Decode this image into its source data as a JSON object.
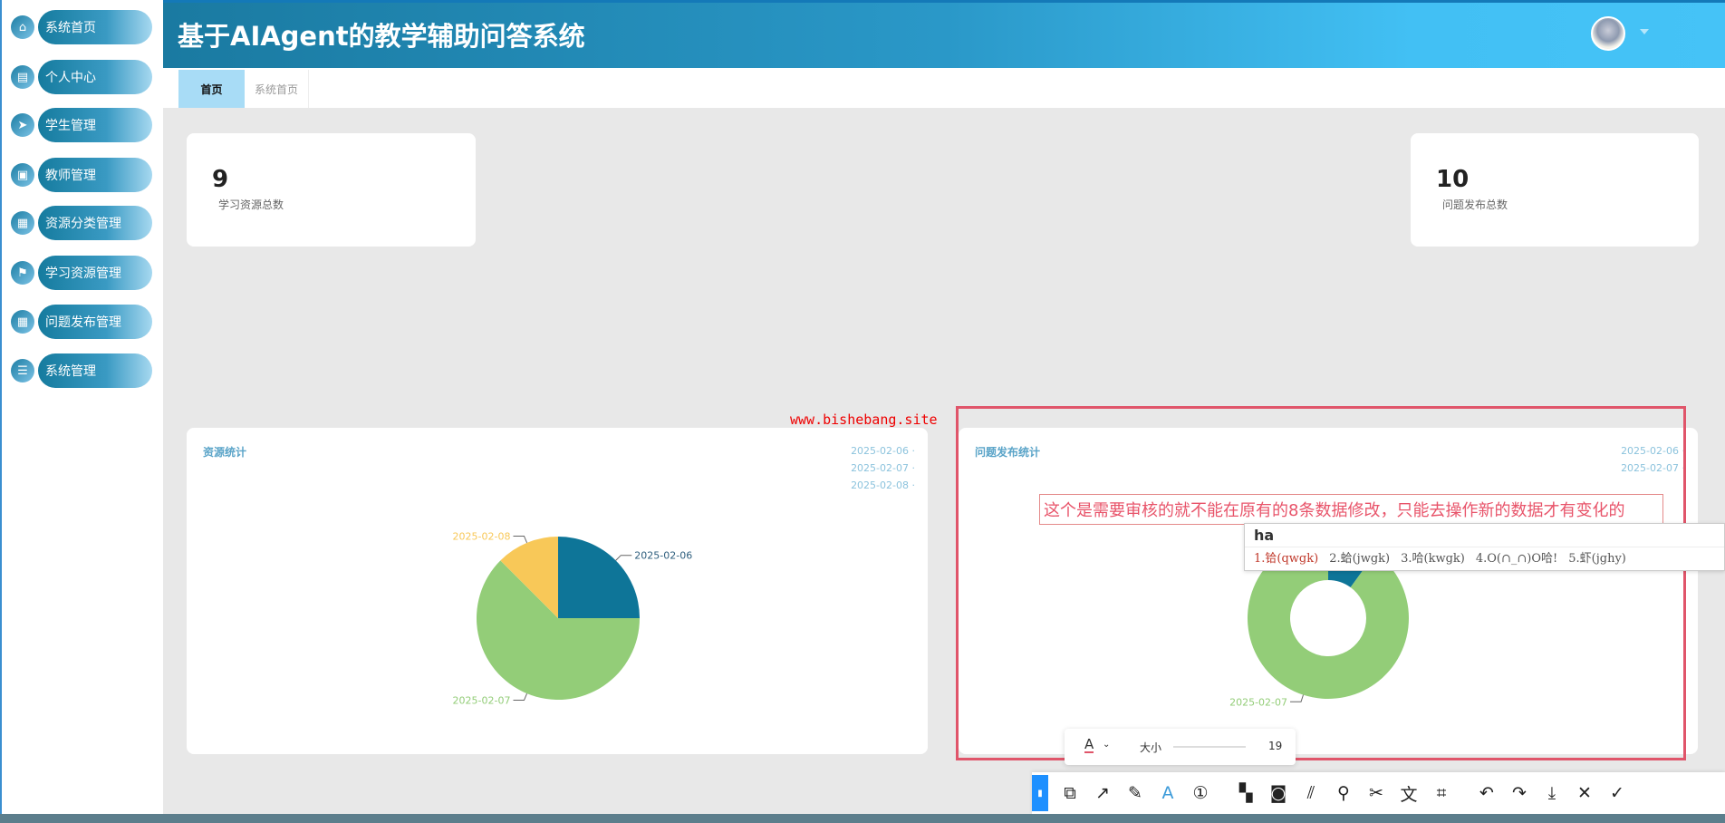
{
  "header": {
    "title": "基于AIAgent的教学辅助问答系统"
  },
  "sidebar": {
    "items": [
      {
        "label": "系统首页",
        "icon": "home-icon",
        "glyph": "⌂"
      },
      {
        "label": "个人中心",
        "icon": "id-card-icon",
        "glyph": "▤"
      },
      {
        "label": "学生管理",
        "icon": "paper-plane-icon",
        "glyph": "➤"
      },
      {
        "label": "教师管理",
        "icon": "clipboard-icon",
        "glyph": "▣"
      },
      {
        "label": "资源分类管理",
        "icon": "grid-icon",
        "glyph": "▦"
      },
      {
        "label": "学习资源管理",
        "icon": "flag-icon",
        "glyph": "⚑"
      },
      {
        "label": "问题发布管理",
        "icon": "grid-icon",
        "glyph": "▦"
      },
      {
        "label": "系统管理",
        "icon": "sliders-icon",
        "glyph": "☰"
      }
    ]
  },
  "tabs": [
    {
      "label": "首页"
    },
    {
      "label": "系统首页"
    }
  ],
  "stats": [
    {
      "value": "9",
      "label": "学习资源总数"
    },
    {
      "value": "10",
      "label": "问题发布总数"
    }
  ],
  "chart_data": [
    {
      "type": "pie",
      "title": "资源统计",
      "categories": [
        "2025-02-06",
        "2025-02-07",
        "2025-02-08"
      ],
      "values": [
        2,
        5,
        1
      ],
      "colors": [
        "#0e7598",
        "#93cd78",
        "#f8c858"
      ],
      "legend": [
        "2025-02-06",
        "2025-02-07",
        "2025-02-08"
      ],
      "legend_position": "top-right"
    },
    {
      "type": "pie",
      "title": "问题发布统计",
      "donut": true,
      "categories": [
        "2025-02-06",
        "2025-02-07"
      ],
      "values": [
        1,
        9
      ],
      "colors": [
        "#0e7598",
        "#93cd78"
      ],
      "legend": [
        "2025-02-06",
        "2025-02-07"
      ],
      "legend_position": "top-right"
    }
  ],
  "overlay": {
    "watermark": "www.bishebang.site",
    "annotation": "这个是需要审核的就不能在原有的8条数据修改，只能去操作新的数据才有变化的",
    "ime_input": "ha",
    "ime_candidates": [
      "1.铪(qwgk)",
      "2.蛤(jwgk)",
      "3.哈(kwgk)",
      "4.O(∩_∩)O哈!",
      "5.虾(jghy)"
    ],
    "font_size_label": "大小",
    "font_size": "19",
    "font_color_label": "A"
  },
  "toolbar": [
    {
      "name": "pin-tool",
      "glyph": "▮"
    },
    {
      "name": "shape-tool",
      "glyph": "⧉"
    },
    {
      "name": "arrow-tool",
      "glyph": "↗"
    },
    {
      "name": "pen-tool",
      "glyph": "✎"
    },
    {
      "name": "text-tool",
      "glyph": "A"
    },
    {
      "name": "number-tool",
      "glyph": "①"
    },
    {
      "name": "mosaic-tool",
      "glyph": "▚"
    },
    {
      "name": "blur-tool",
      "glyph": "◙"
    },
    {
      "name": "hatch-tool",
      "glyph": "⫽"
    },
    {
      "name": "pin-top-tool",
      "glyph": "⚲"
    },
    {
      "name": "cut-tool",
      "glyph": "✂"
    },
    {
      "name": "translate-tool",
      "glyph": "文"
    },
    {
      "name": "ocr-tool",
      "glyph": "⌗"
    },
    {
      "name": "undo",
      "glyph": "↶"
    },
    {
      "name": "redo",
      "glyph": "↷"
    },
    {
      "name": "download",
      "glyph": "⤓"
    },
    {
      "name": "close",
      "glyph": "✕"
    },
    {
      "name": "confirm",
      "glyph": "✓"
    }
  ]
}
